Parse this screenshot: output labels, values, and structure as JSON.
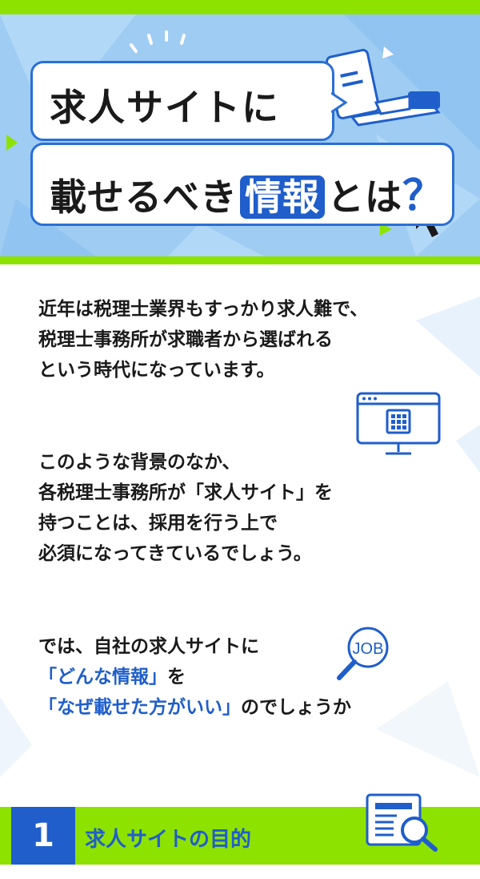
{
  "hero": {
    "title_line1": "求人サイトに",
    "title_line2_a": "載せるべき",
    "title_line2_highlight": "情報",
    "title_line2_b": "とは",
    "title_line2_q": "？"
  },
  "body": {
    "p1_l1": "近年は税理士業界もすっかり求人難で、",
    "p1_l2": "税理士事務所が求職者から選ばれる",
    "p1_l3": "という時代になっています。",
    "p2_l1": "このような背景のなか、",
    "p2_l2": "各税理士事務所が「求人サイト」を",
    "p2_l3": "持つことは、採用を行う上で",
    "p2_l4": "必須になってきているでしょう。",
    "p3_l1": "では、自社の求人サイトに",
    "p3_l2_blue": "「どんな情報」",
    "p3_l2_rest": "を",
    "p3_l3_blue": "「なぜ載せた方がいい」",
    "p3_l3_rest": "のでしょうか",
    "job_badge": "JOB"
  },
  "section": {
    "number": "1",
    "title": "求人サイトの目的"
  },
  "colors": {
    "accent_blue": "#1f5ecb",
    "green": "#8ee200",
    "hero_bg": "#9fccf3"
  }
}
